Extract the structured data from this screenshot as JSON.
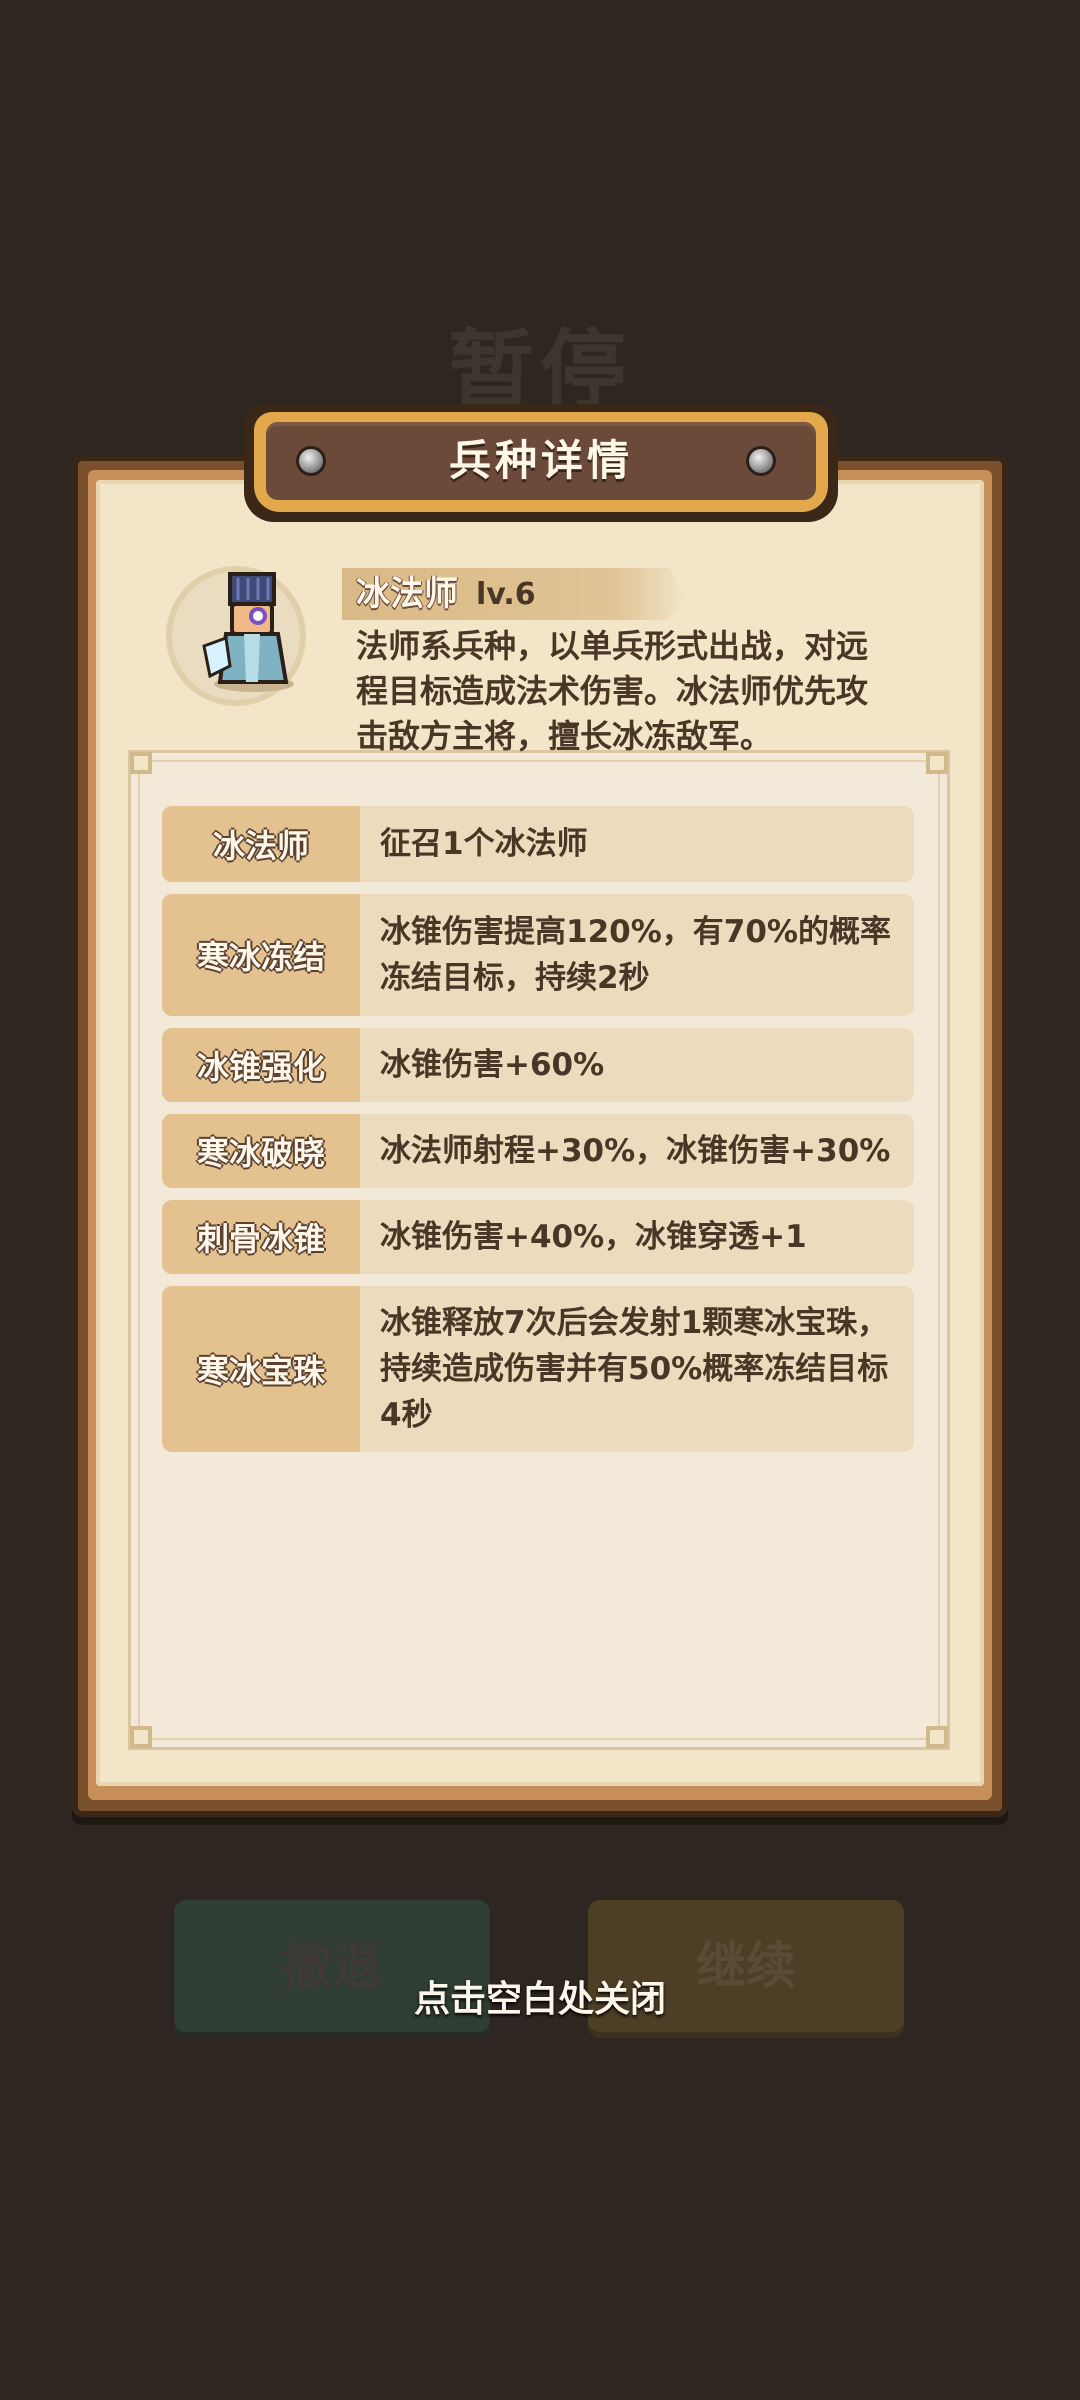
{
  "background": {
    "pause_title": "暂停",
    "retreat_label": "撤退",
    "continue_label": "继续"
  },
  "dialog": {
    "title": "兵种详情",
    "unit": {
      "name": "冰法师",
      "level": "lv.6",
      "description": "法师系兵种，以单兵形式出战，对远程目标造成法术伤害。冰法师优先攻击敌方主将，擅长冰冻敌军。"
    },
    "skills": [
      {
        "name": "冰法师",
        "desc": "征召1个冰法师"
      },
      {
        "name": "寒冰冻结",
        "desc": "冰锥伤害提高120%，有70%的概率冻结目标，持续2秒"
      },
      {
        "name": "冰锥强化",
        "desc": "冰锥伤害+60%"
      },
      {
        "name": "寒冰破晓",
        "desc": "冰法师射程+30%，冰锥伤害+30%"
      },
      {
        "name": "刺骨冰锥",
        "desc": "冰锥伤害+40%，冰锥穿透+1"
      },
      {
        "name": "寒冰宝珠",
        "desc": "冰锥释放7次后会发射1颗寒冰宝珠，持续造成伤害并有50%概率冻结目标4秒"
      }
    ]
  },
  "close_hint": "点击空白处关闭",
  "colors": {
    "overlay": "#2e2721",
    "parchment": "#f2e5c8",
    "row_label": "#e3c290",
    "row_desc": "#ecdcbd",
    "text_dark": "#4a3626"
  }
}
